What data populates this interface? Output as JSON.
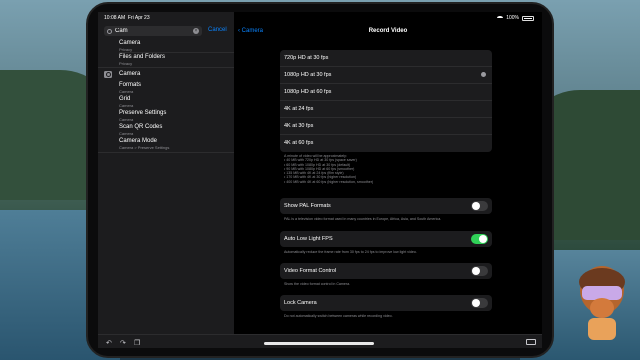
{
  "status_bar": {
    "time": "10:08 AM",
    "date": "Fri Apr 23",
    "battery": "100%"
  },
  "search": {
    "value": "Cam",
    "cancel_label": "Cancel"
  },
  "results": [
    {
      "title": "Camera",
      "subtitle": "Privacy"
    },
    {
      "title": "Files and Folders",
      "subtitle": "Privacy"
    }
  ],
  "camera_app": {
    "title": "Camera"
  },
  "camera_results": [
    {
      "title": "Formats",
      "subtitle": "Camera"
    },
    {
      "title": "Grid",
      "subtitle": "Camera"
    },
    {
      "title": "Preserve Settings",
      "subtitle": "Camera"
    },
    {
      "title": "Scan QR Codes",
      "subtitle": "Camera"
    },
    {
      "title": "Camera Mode",
      "subtitle": "Camera > Preserve Settings"
    }
  ],
  "nav": {
    "back_label": "Camera",
    "title": "Record Video"
  },
  "video_options": [
    {
      "label": "720p HD at 30 fps"
    },
    {
      "label": "1080p HD at 30 fps",
      "selected": true
    },
    {
      "label": "1080p HD at 60 fps"
    },
    {
      "label": "4K at 24 fps"
    },
    {
      "label": "4K at 30 fps"
    },
    {
      "label": "4K at 60 fps"
    }
  ],
  "storage_note": [
    "A minute of video will be approximately:",
    "• 40 MB with 720p HD at 30 fps (space saver)",
    "• 60 MB with 1080p HD at 30 fps (default)",
    "• 90 MB with 1080p HD at 60 fps (smoother)",
    "• 135 MB with 4K at 24 fps (film style)",
    "• 170 MB with 4K at 30 fps (higher resolution)",
    "• 400 MB with 4K at 60 fps (higher resolution, smoother)"
  ],
  "toggles": [
    {
      "label": "Show PAL Formats",
      "on": false,
      "note": "PAL is a television video format used in many countries in Europe, Africa, Asia, and South America."
    },
    {
      "label": "Auto Low Light FPS",
      "on": true,
      "note": "Automatically reduce the frame rate from 30 fps to 24 fps to improve low light video."
    },
    {
      "label": "Video Format Control",
      "on": false,
      "note": "Show the video format control in Camera."
    },
    {
      "label": "Lock Camera",
      "on": false,
      "note": "Do not automatically switch between cameras while recording video."
    }
  ],
  "colors": {
    "accent": "#0a84ff",
    "toggle_on": "#30d158",
    "panel": "#1c1c1e"
  }
}
